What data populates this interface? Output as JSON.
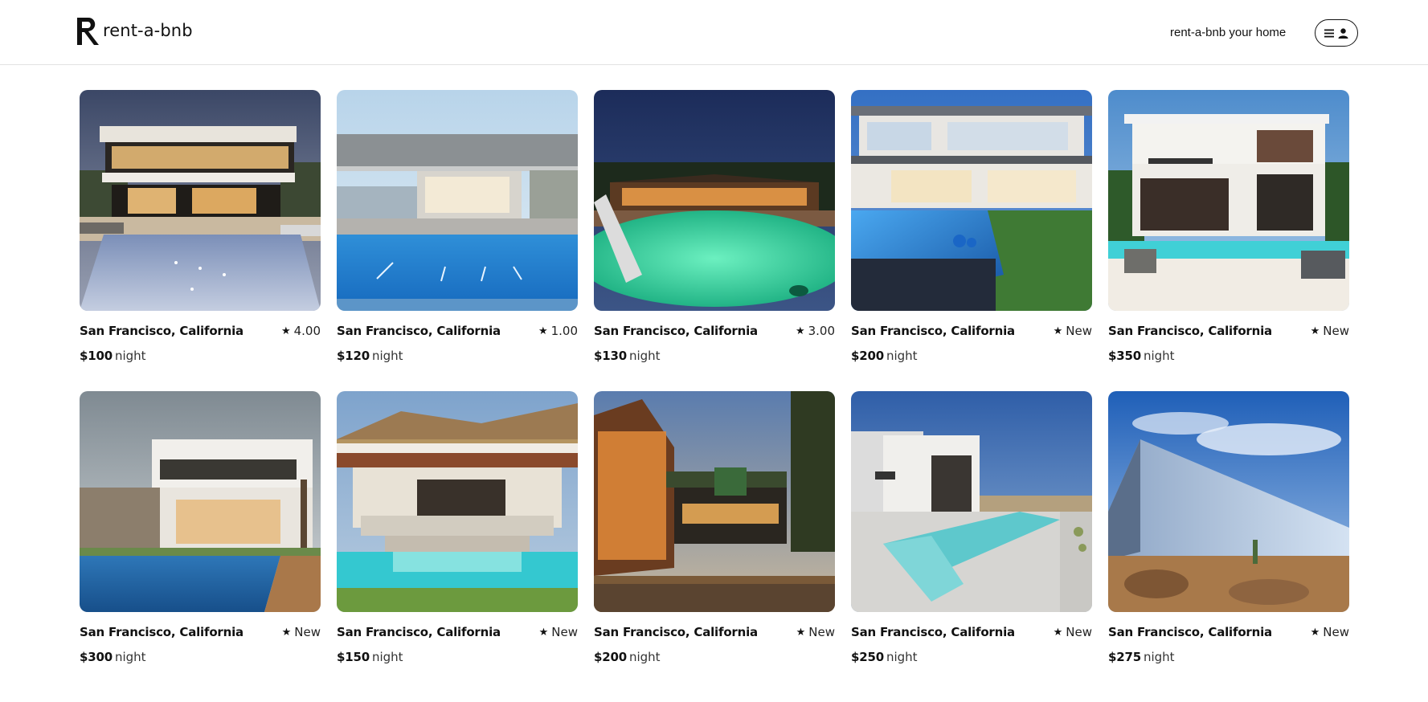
{
  "header": {
    "brand": "rent-a-bnb",
    "host_link": "rent-a-bnb your home"
  },
  "listings": [
    {
      "location": "San Francisco, California",
      "rating": "4.00",
      "price": "$100",
      "unit": "night"
    },
    {
      "location": "San Francisco, California",
      "rating": "1.00",
      "price": "$120",
      "unit": "night"
    },
    {
      "location": "San Francisco, California",
      "rating": "3.00",
      "price": "$130",
      "unit": "night"
    },
    {
      "location": "San Francisco, California",
      "rating": "New",
      "price": "$200",
      "unit": "night"
    },
    {
      "location": "San Francisco, California",
      "rating": "New",
      "price": "$350",
      "unit": "night"
    },
    {
      "location": "San Francisco, California",
      "rating": "New",
      "price": "$300",
      "unit": "night"
    },
    {
      "location": "San Francisco, California",
      "rating": "New",
      "price": "$150",
      "unit": "night"
    },
    {
      "location": "San Francisco, California",
      "rating": "New",
      "price": "$200",
      "unit": "night"
    },
    {
      "location": "San Francisco, California",
      "rating": "New",
      "price": "$250",
      "unit": "night"
    },
    {
      "location": "San Francisco, California",
      "rating": "New",
      "price": "$275",
      "unit": "night"
    }
  ],
  "icons": {
    "rating": "star-icon",
    "menu": "hamburger-icon",
    "user": "user-icon"
  }
}
